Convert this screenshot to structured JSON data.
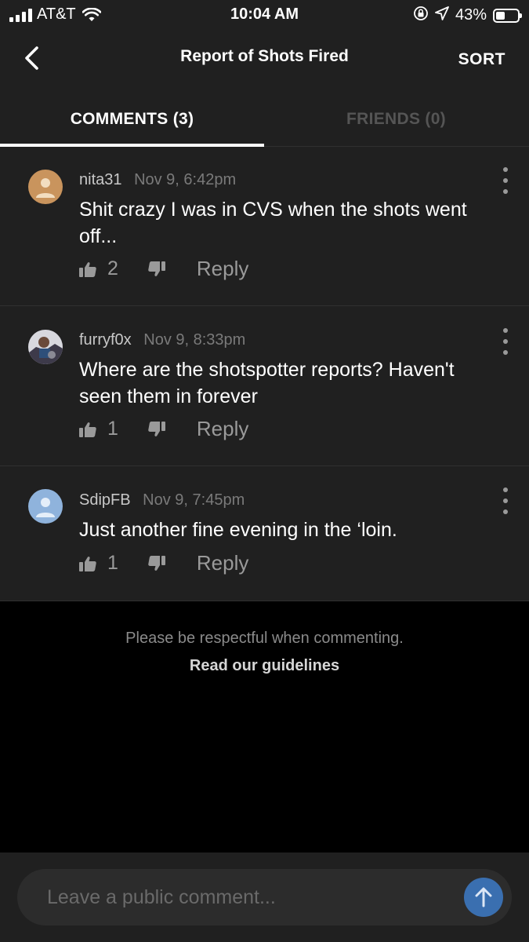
{
  "status_bar": {
    "carrier": "AT&T",
    "time": "10:04 AM",
    "battery_percent": "43%",
    "battery_level": 0.43,
    "icons": [
      "signal-icon",
      "wifi-icon",
      "orientation-lock-icon",
      "location-icon",
      "battery-icon"
    ]
  },
  "header": {
    "back_icon": "chevron-left-icon",
    "title": "Report of Shots Fired",
    "sort_label": "SORT"
  },
  "tabs": [
    {
      "label": "COMMENTS (3)",
      "active": true
    },
    {
      "label": "FRIENDS (0)",
      "active": false
    }
  ],
  "comments": [
    {
      "username": "nita31",
      "timestamp": "Nov 9, 6:42pm",
      "body": "Shit crazy I was in CVS when the shots went off...",
      "likes": "2",
      "reply_label": "Reply",
      "avatar_color": "#c9945d"
    },
    {
      "username": "furryf0x",
      "timestamp": "Nov 9, 8:33pm",
      "body": "Where are the shotspotter reports? Haven't seen them in forever",
      "likes": "1",
      "reply_label": "Reply",
      "avatar_color": "#5a5060"
    },
    {
      "username": "SdipFB",
      "timestamp": "Nov 9, 7:45pm",
      "body": "Just another fine evening in the ‘loin.",
      "likes": "1",
      "reply_label": "Reply",
      "avatar_color": "#8fb3dc"
    }
  ],
  "footer": {
    "respect_text": "Please be respectful when commenting.",
    "guidelines_label": "Read our guidelines"
  },
  "composer": {
    "placeholder": "Leave a public comment...",
    "send_icon": "arrow-up-icon",
    "send_color": "#3a6fb0"
  }
}
